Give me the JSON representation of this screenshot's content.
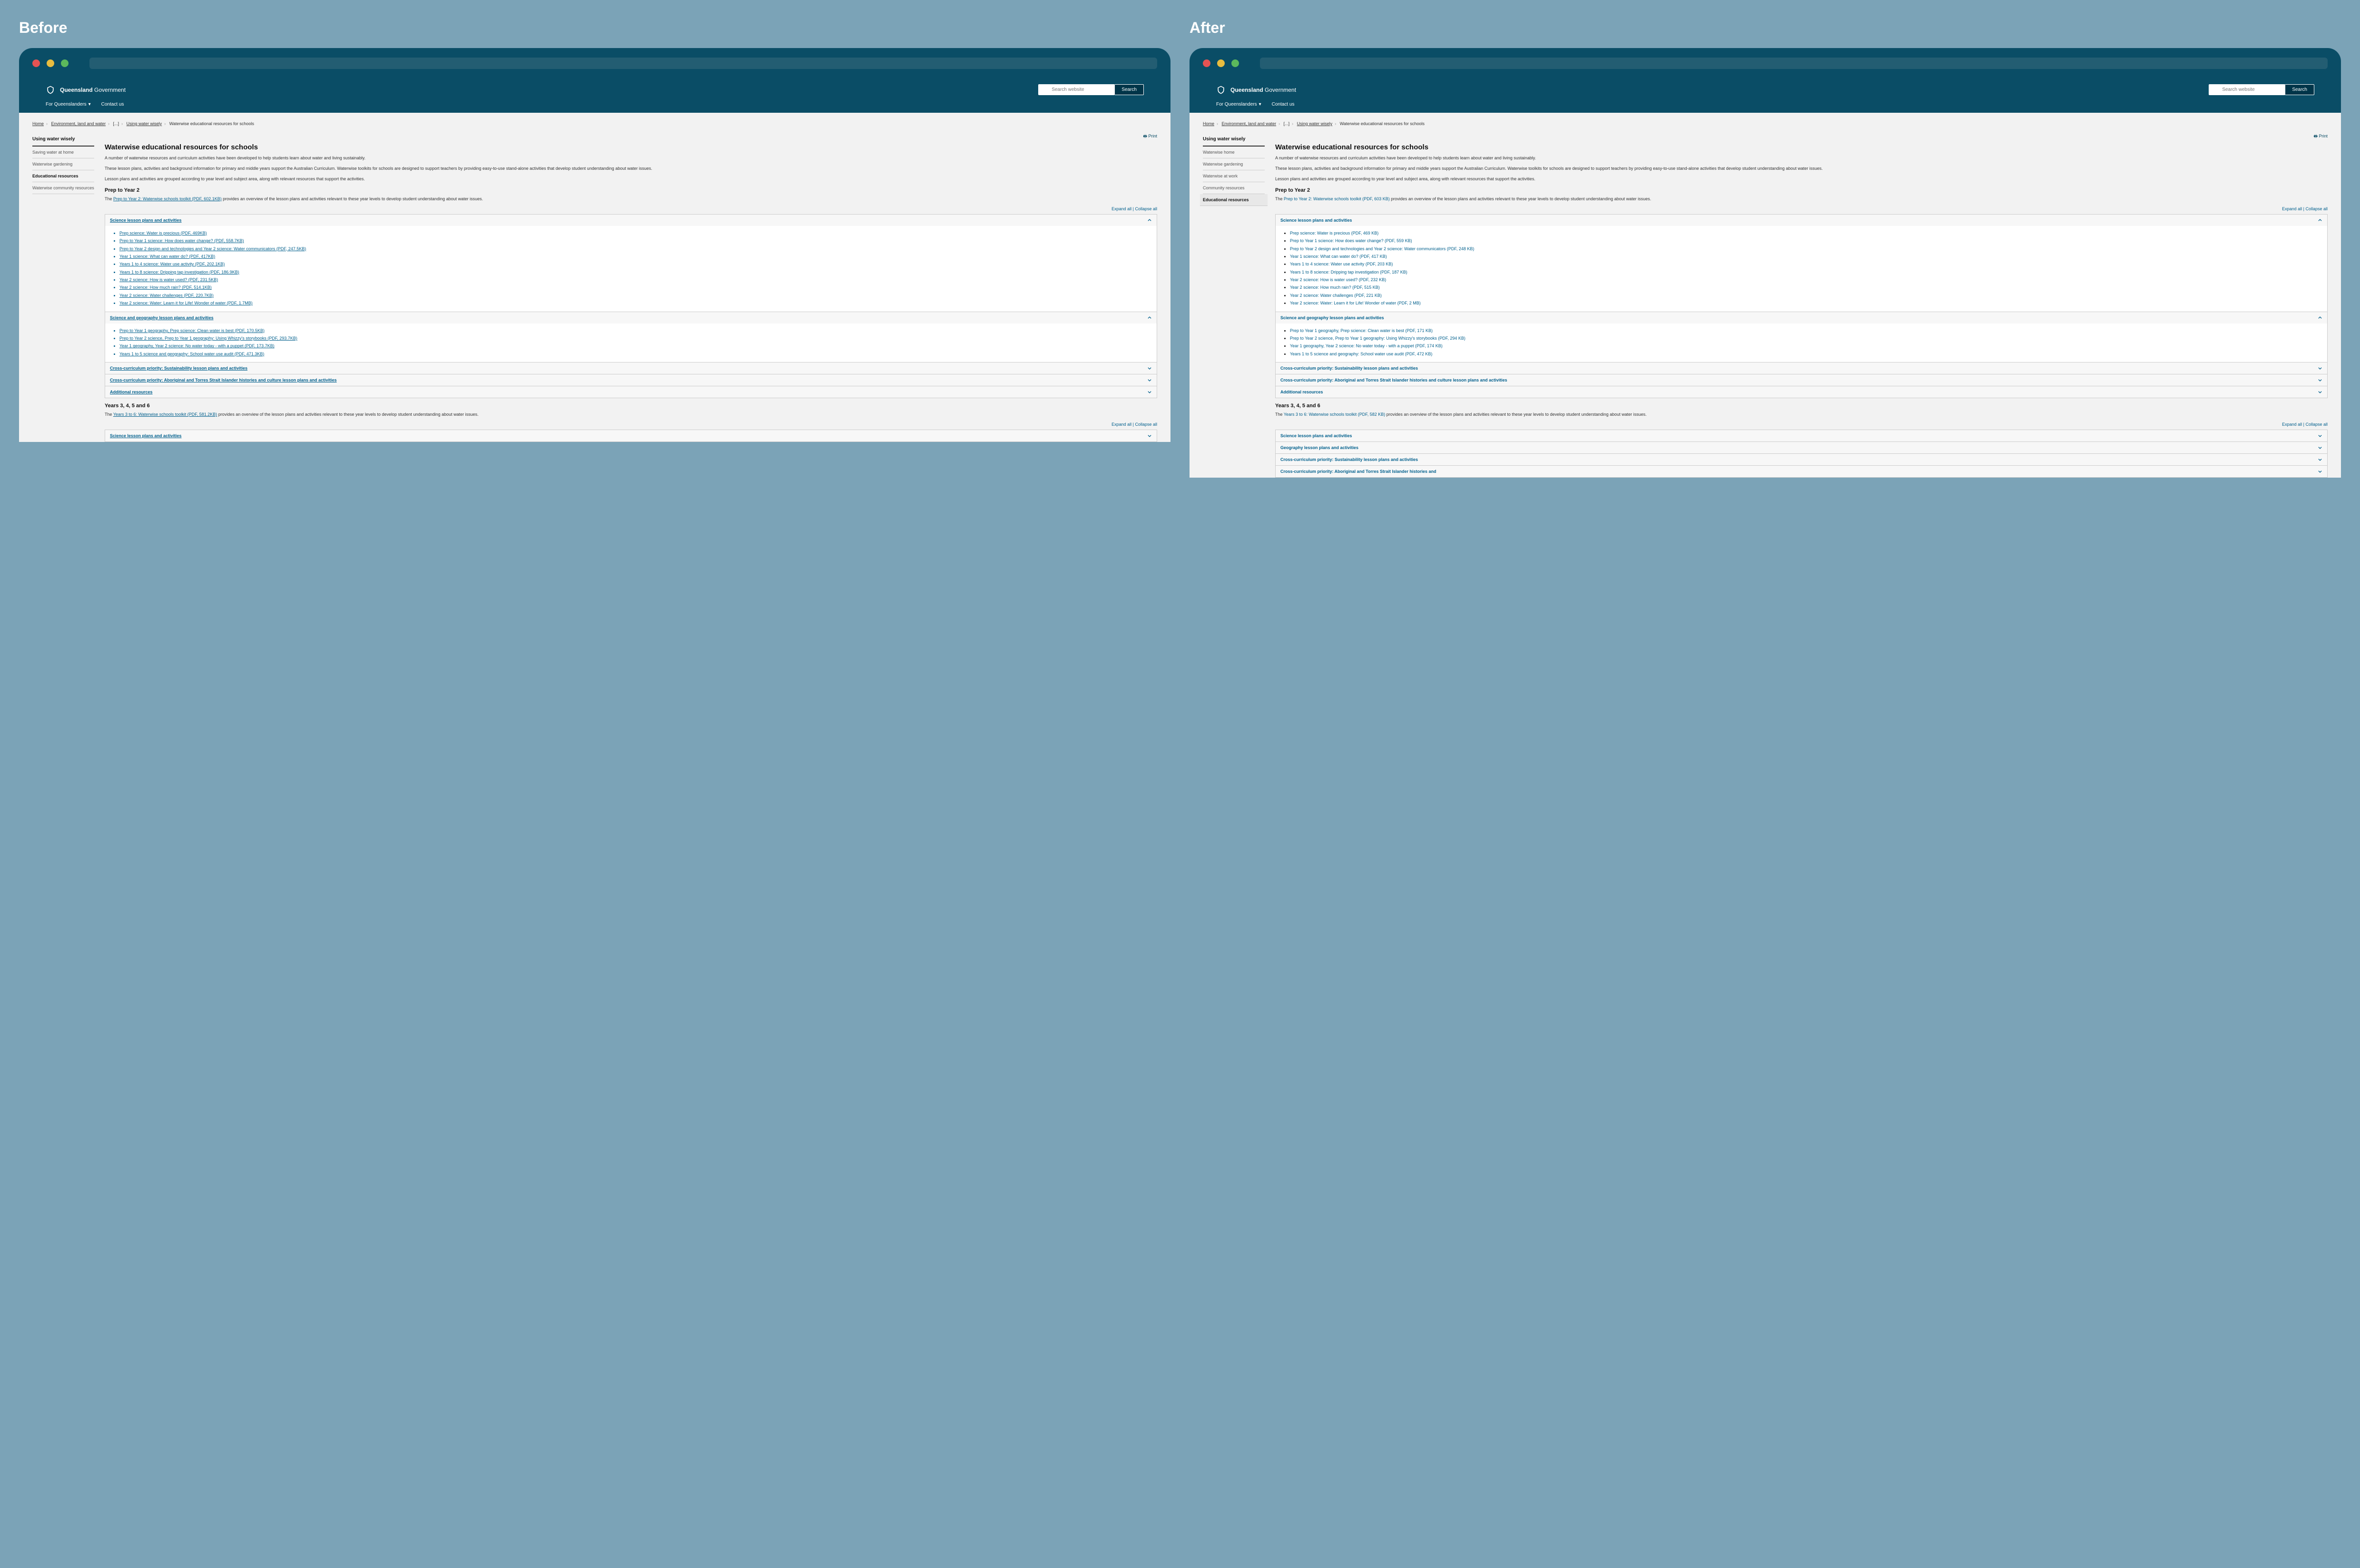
{
  "labels": {
    "before": "Before",
    "after": "After"
  },
  "brand": {
    "name_bold": "Queensland",
    "name_light": " Government"
  },
  "search": {
    "placeholder": "Search website",
    "button": "Search"
  },
  "nav": {
    "item1": "For Queenslanders",
    "item2": "Contact us"
  },
  "breadcrumb": {
    "home": "Home",
    "env": "Environment, land and water",
    "ellipsis": "[...]",
    "using": "Using water wisely",
    "current": "Waterwise educational resources for schools"
  },
  "sidebar_before": {
    "heading": "Using water wisely",
    "items": [
      "Saving water at home",
      "Waterwise gardening",
      "Educational resources",
      "Waterwise community resources"
    ],
    "active_index": 2
  },
  "sidebar_after": {
    "heading": "Using water wisely",
    "items": [
      "Waterwise home",
      "Waterwise gardening",
      "Waterwise at work",
      "Community resources",
      "Educational resources"
    ],
    "active_index": 4
  },
  "print": "Print",
  "page": {
    "title": "Waterwise educational resources for schools",
    "p1": "A number of waterwise resources and curriculum activities have been developed to help students learn about water and living sustainably.",
    "p2": "These lesson plans, activities and background information for primary and middle years support the Australian Curriculum. Waterwise toolkits for schools are designed to support teachers by providing easy-to-use stand-alone activities that develop student understanding about water issues.",
    "p3": "Lesson plans and activities are grouped according to year level and subject area, along with relevant resources that support the activities."
  },
  "prep": {
    "heading": "Prep to Year 2",
    "intro_pre": "The ",
    "intro_post": " provides an overview of the lesson plans and activities relevant to these year levels to develop student understanding about water issues.",
    "link_before": "Prep to Year 2: Waterwise schools toolkit (PDF, 602.1KB)",
    "link_after": "Prep to Year 2: Waterwise schools toolkit (PDF, 603 KB)"
  },
  "expand": "Expand all",
  "divider": "  |  ",
  "collapse": "Collapse all",
  "acc_science": "Science lesson plans and activities",
  "acc_scigeo": "Science and geography lesson plans and activities",
  "acc_sust": "Cross-curriculum priority: Sustainability lesson plans and activities",
  "acc_atsi": "Cross-curriculum priority: Aboriginal and Torres Strait Islander histories and culture lesson plans and activities",
  "acc_additional": "Additional resources",
  "acc_geo": "Geography lesson plans and activities",
  "acc_atsi_short": "Cross-curriculum priority: Aboriginal and Torres Strait Islander histories and",
  "science_before": [
    "Prep science: Water is precious (PDF, 469KB)",
    "Prep to Year 1 science: How does water change? (PDF, 558.7KB)",
    "Prep to Year 2 design and technologies and Year 2 science: Water communicators (PDF, 247.5KB)",
    "Year 1 science: What can water do? (PDF, 417KB)",
    "Years 1 to 4 science: Water use activity (PDF, 202.1KB)",
    "Years 1 to 8 science: Dripping tap investigation (PDF, 186.9KB)",
    "Year 2 science: How is water used? (PDF, 231.5KB)",
    "Year 2 science: How much rain? (PDF, 514.1KB)",
    "Year 2 science: Water challenges (PDF, 220.7KB)",
    "Year 2 science: Water: Learn it for Life! Wonder of water (PDF, 1.7MB)"
  ],
  "science_after": [
    "Prep science: Water is precious (PDF, 469 KB)",
    "Prep to Year 1 science: How does water change? (PDF, 559 KB)",
    "Prep to Year 2 design and technologies and Year 2 science: Water communicators (PDF, 248 KB)",
    "Year 1 science: What can water do? (PDF, 417 KB)",
    "Years 1 to 4 science: Water use activity (PDF, 203 KB)",
    "Years 1 to 8 science: Dripping tap investigation (PDF, 187 KB)",
    "Year 2 science: How is water used? (PDF, 232 KB)",
    "Year 2 science: How much rain? (PDF, 515 KB)",
    "Year 2 science: Water challenges (PDF, 221 KB)",
    "Year 2 science: Water: Learn it for Life! Wonder of water (PDF, 2 MB)"
  ],
  "scigeo_before": [
    "Prep to Year 1 geography, Prep science: Clean water is best (PDF, 170.5KB)",
    "Prep to Year 2 science, Prep to Year 1 geography: Using Whizzy's storybooks (PDF, 293.7KB)",
    "Year 1 geography, Year 2 science: No water today - with a puppet (PDF, 173.7KB)",
    "Years 1 to 5 science and geography: School water use audit (PDF, 471.3KB)"
  ],
  "scigeo_after": [
    "Prep to Year 1 geography, Prep science: Clean water is best (PDF, 171 KB)",
    "Prep to Year 2 science, Prep to Year 1 geography: Using Whizzy's storybooks (PDF, 294 KB)",
    "Year 1 geography, Year 2 science: No water today - with a puppet (PDF, 174 KB)",
    "Years 1 to 5 science and geography: School water use audit (PDF, 472 KB)"
  ],
  "years345": {
    "heading": "Years 3, 4, 5 and 6",
    "intro_pre": "The ",
    "intro_post": " provides an overview of the lesson plans and activities relevant to these year levels to develop student understanding about water issues.",
    "link_before": "Years 3 to 6: Waterwise schools toolkit (PDF, 581.2KB)",
    "link_after": "Years 3 to 6: Waterwise schools toolkit (PDF, 582 KB)"
  }
}
